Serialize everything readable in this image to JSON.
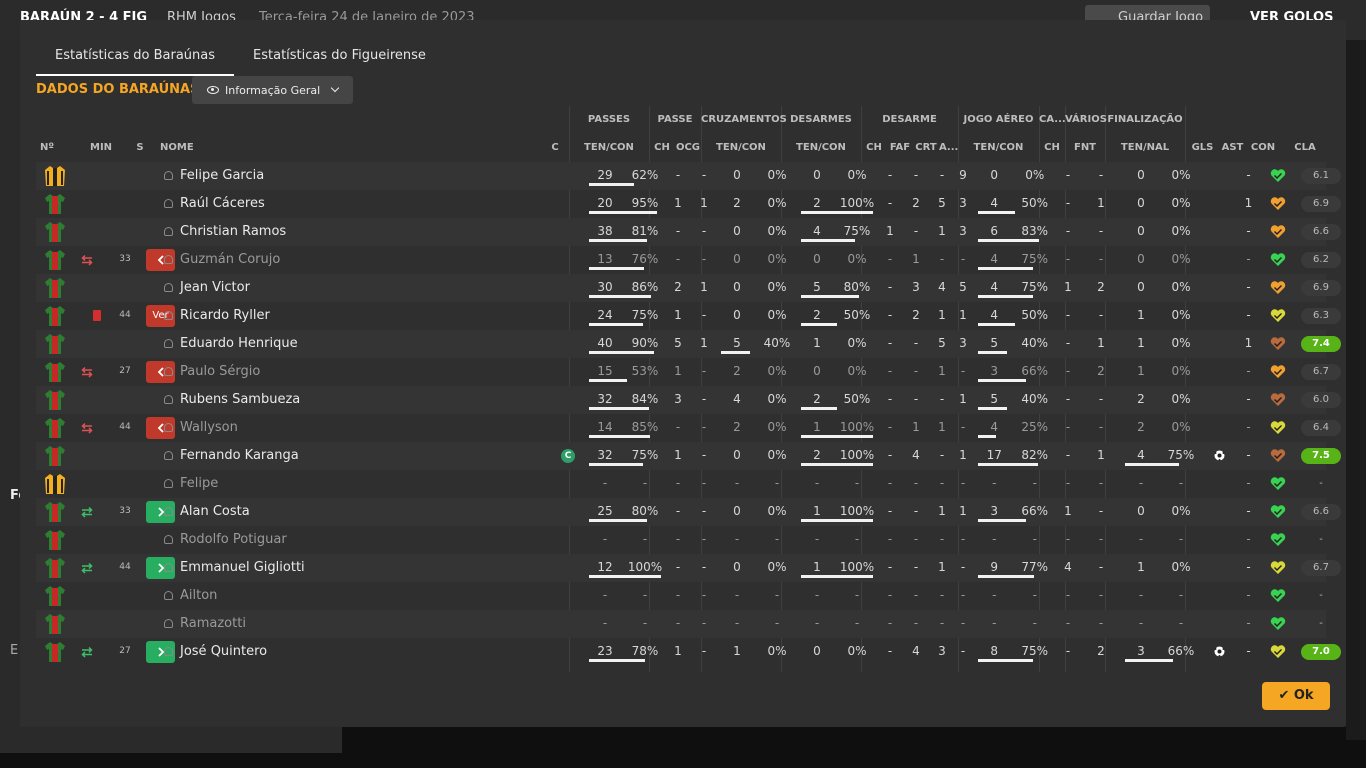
{
  "background": {
    "score": "BARAÚN 2 - 4 FIG",
    "channel": "RHM Jogos",
    "date": "Terça-feira 24 de Janeiro de 2023",
    "save_button": "Guardar Jogo",
    "goals_button": "VER GOLOS",
    "side_letter_1": "Fo",
    "side_letter_2": "E"
  },
  "tabs": [
    {
      "label": "Estatísticas do Baraúnas",
      "active": true
    },
    {
      "label": "Estatísticas do Figueirense",
      "active": false
    }
  ],
  "team_title": "DADOS DO BARAÚNAS",
  "view_dropdown": {
    "label": "Informação Geral",
    "icon": "eye-icon"
  },
  "group_headers": [
    "PASSES",
    "PASSE",
    "CRUZAMENTOS",
    "DESARMES",
    "DESARME",
    "JOGO AÉREO",
    "CA...",
    "VÁRIOS",
    "FINALIZAÇÃO"
  ],
  "columns": [
    "Nº",
    "MIN",
    "S",
    "NOME",
    "C",
    "TEN/CON",
    "CH",
    "OCG",
    "TEN/CON",
    "TEN/CON",
    "CH",
    "FAF",
    "CRT",
    "A...",
    "TEN/CON",
    "CH",
    "FNT",
    "TEN/NAL",
    "GLS",
    "AST",
    "CON",
    "CLA"
  ],
  "players": [
    {
      "name": "Felipe Garcia",
      "kit": "gk",
      "s": "",
      "min": "",
      "sub": "",
      "card": false,
      "captain": false,
      "dim": false,
      "passes": [
        "29",
        "62%"
      ],
      "passes_pct": 62,
      "passe": [
        "-",
        "-"
      ],
      "cruz": [
        "0",
        "0%"
      ],
      "cruz_pct": 0,
      "desarmes": [
        "0",
        "0%"
      ],
      "desarmes_pct": 0,
      "desarme": [
        "-",
        "-",
        "-",
        "9"
      ],
      "aereo": [
        "0",
        "0%"
      ],
      "aereo_pct": 0,
      "ca": "-",
      "fnt": "-",
      "fin": [
        "0",
        "0%"
      ],
      "fin_pct": 0,
      "gls": "",
      "ball": false,
      "ast": "-",
      "morale": "green",
      "rating": "6.1",
      "rating_hi": false
    },
    {
      "name": "Raúl Cáceres",
      "kit": "field",
      "s": "",
      "min": "",
      "sub": "",
      "card": false,
      "captain": false,
      "dim": false,
      "passes": [
        "20",
        "95%"
      ],
      "passes_pct": 95,
      "passe": [
        "1",
        "1"
      ],
      "cruz": [
        "2",
        "0%"
      ],
      "cruz_pct": 0,
      "desarmes": [
        "2",
        "100%"
      ],
      "desarmes_pct": 100,
      "desarme": [
        "-",
        "2",
        "5",
        "3"
      ],
      "aereo": [
        "4",
        "50%"
      ],
      "aereo_pct": 50,
      "ca": "-",
      "fnt": "1",
      "fin": [
        "0",
        "0%"
      ],
      "fin_pct": 0,
      "gls": "",
      "ball": false,
      "ast": "1",
      "morale": "orange",
      "rating": "6.9",
      "rating_hi": false
    },
    {
      "name": "Christian Ramos",
      "kit": "field",
      "s": "",
      "min": "",
      "sub": "",
      "card": false,
      "captain": false,
      "dim": false,
      "passes": [
        "38",
        "81%"
      ],
      "passes_pct": 81,
      "passe": [
        "-",
        "-"
      ],
      "cruz": [
        "0",
        "0%"
      ],
      "cruz_pct": 0,
      "desarmes": [
        "4",
        "75%"
      ],
      "desarmes_pct": 75,
      "desarme": [
        "1",
        "-",
        "1",
        "3"
      ],
      "aereo": [
        "6",
        "83%"
      ],
      "aereo_pct": 83,
      "ca": "-",
      "fnt": "-",
      "fin": [
        "0",
        "0%"
      ],
      "fin_pct": 0,
      "gls": "",
      "ball": false,
      "ast": "-",
      "morale": "orange",
      "rating": "6.6",
      "rating_hi": false
    },
    {
      "name": "Guzmán Corujo",
      "kit": "field",
      "s": "out",
      "min": "33",
      "sub": "out",
      "card": false,
      "captain": false,
      "dim": true,
      "passes": [
        "13",
        "76%"
      ],
      "passes_pct": 76,
      "passe": [
        "-",
        "-"
      ],
      "cruz": [
        "0",
        "0%"
      ],
      "cruz_pct": 0,
      "desarmes": [
        "0",
        "0%"
      ],
      "desarmes_pct": 0,
      "desarme": [
        "-",
        "1",
        "-",
        "-"
      ],
      "aereo": [
        "4",
        "75%"
      ],
      "aereo_pct": 75,
      "ca": "-",
      "fnt": "-",
      "fin": [
        "0",
        "0%"
      ],
      "fin_pct": 0,
      "gls": "",
      "ball": false,
      "ast": "-",
      "morale": "green",
      "rating": "6.2",
      "rating_hi": false
    },
    {
      "name": "Jean Victor",
      "kit": "field",
      "s": "",
      "min": "",
      "sub": "",
      "card": false,
      "captain": false,
      "dim": false,
      "passes": [
        "30",
        "86%"
      ],
      "passes_pct": 86,
      "passe": [
        "2",
        "1"
      ],
      "cruz": [
        "0",
        "0%"
      ],
      "cruz_pct": 0,
      "desarmes": [
        "5",
        "80%"
      ],
      "desarmes_pct": 80,
      "desarme": [
        "-",
        "3",
        "4",
        "5"
      ],
      "aereo": [
        "4",
        "75%"
      ],
      "aereo_pct": 75,
      "ca": "1",
      "fnt": "2",
      "fin": [
        "0",
        "0%"
      ],
      "fin_pct": 0,
      "gls": "",
      "ball": false,
      "ast": "-",
      "morale": "orange",
      "rating": "6.9",
      "rating_hi": false
    },
    {
      "name": "Ricardo Ryller",
      "kit": "field",
      "s": "ver",
      "min": "44",
      "sub": "",
      "card": true,
      "captain": false,
      "dim": false,
      "passes": [
        "24",
        "75%"
      ],
      "passes_pct": 75,
      "passe": [
        "1",
        "-"
      ],
      "cruz": [
        "0",
        "0%"
      ],
      "cruz_pct": 0,
      "desarmes": [
        "2",
        "50%"
      ],
      "desarmes_pct": 50,
      "desarme": [
        "-",
        "2",
        "1",
        "1"
      ],
      "aereo": [
        "4",
        "50%"
      ],
      "aereo_pct": 50,
      "ca": "-",
      "fnt": "-",
      "fin": [
        "1",
        "0%"
      ],
      "fin_pct": 0,
      "gls": "",
      "ball": false,
      "ast": "-",
      "morale": "yellow",
      "rating": "6.3",
      "rating_hi": false
    },
    {
      "name": "Eduardo Henrique",
      "kit": "field",
      "s": "",
      "min": "",
      "sub": "",
      "card": false,
      "captain": false,
      "dim": false,
      "passes": [
        "40",
        "90%"
      ],
      "passes_pct": 90,
      "passe": [
        "5",
        "1"
      ],
      "cruz": [
        "5",
        "40%"
      ],
      "cruz_pct": 40,
      "desarmes": [
        "1",
        "0%"
      ],
      "desarmes_pct": 0,
      "desarme": [
        "-",
        "-",
        "5",
        "3"
      ],
      "aereo": [
        "5",
        "40%"
      ],
      "aereo_pct": 40,
      "ca": "-",
      "fnt": "1",
      "fin": [
        "1",
        "0%"
      ],
      "fin_pct": 0,
      "gls": "",
      "ball": false,
      "ast": "1",
      "morale": "brown",
      "rating": "7.4",
      "rating_hi": true
    },
    {
      "name": "Paulo Sérgio",
      "kit": "field",
      "s": "out",
      "min": "27",
      "sub": "out",
      "card": false,
      "captain": false,
      "dim": true,
      "passes": [
        "15",
        "53%"
      ],
      "passes_pct": 53,
      "passe": [
        "1",
        "-"
      ],
      "cruz": [
        "2",
        "0%"
      ],
      "cruz_pct": 0,
      "desarmes": [
        "0",
        "0%"
      ],
      "desarmes_pct": 0,
      "desarme": [
        "-",
        "-",
        "1",
        "-"
      ],
      "aereo": [
        "3",
        "66%"
      ],
      "aereo_pct": 66,
      "ca": "-",
      "fnt": "2",
      "fin": [
        "1",
        "0%"
      ],
      "fin_pct": 0,
      "gls": "",
      "ball": false,
      "ast": "-",
      "morale": "orange",
      "rating": "6.7",
      "rating_hi": false
    },
    {
      "name": "Rubens Sambueza",
      "kit": "field",
      "s": "",
      "min": "",
      "sub": "",
      "card": false,
      "captain": false,
      "dim": false,
      "passes": [
        "32",
        "84%"
      ],
      "passes_pct": 84,
      "passe": [
        "3",
        "-"
      ],
      "cruz": [
        "4",
        "0%"
      ],
      "cruz_pct": 0,
      "desarmes": [
        "2",
        "50%"
      ],
      "desarmes_pct": 50,
      "desarme": [
        "-",
        "-",
        "-",
        "1"
      ],
      "aereo": [
        "5",
        "40%"
      ],
      "aereo_pct": 40,
      "ca": "-",
      "fnt": "-",
      "fin": [
        "2",
        "0%"
      ],
      "fin_pct": 0,
      "gls": "",
      "ball": false,
      "ast": "-",
      "morale": "brown",
      "rating": "6.0",
      "rating_hi": false
    },
    {
      "name": "Wallyson",
      "kit": "field",
      "s": "out",
      "min": "44",
      "sub": "out",
      "card": false,
      "captain": false,
      "dim": true,
      "passes": [
        "14",
        "85%"
      ],
      "passes_pct": 85,
      "passe": [
        "-",
        "-"
      ],
      "cruz": [
        "2",
        "0%"
      ],
      "cruz_pct": 0,
      "desarmes": [
        "1",
        "100%"
      ],
      "desarmes_pct": 100,
      "desarme": [
        "-",
        "1",
        "1",
        "-"
      ],
      "aereo": [
        "4",
        "25%"
      ],
      "aereo_pct": 25,
      "ca": "-",
      "fnt": "-",
      "fin": [
        "2",
        "0%"
      ],
      "fin_pct": 0,
      "gls": "",
      "ball": false,
      "ast": "-",
      "morale": "yellow",
      "rating": "6.4",
      "rating_hi": false
    },
    {
      "name": "Fernando Karanga",
      "kit": "field",
      "s": "",
      "min": "",
      "sub": "",
      "card": false,
      "captain": true,
      "dim": false,
      "passes": [
        "32",
        "75%"
      ],
      "passes_pct": 75,
      "passe": [
        "1",
        "-"
      ],
      "cruz": [
        "0",
        "0%"
      ],
      "cruz_pct": 0,
      "desarmes": [
        "2",
        "100%"
      ],
      "desarmes_pct": 100,
      "desarme": [
        "-",
        "4",
        "-",
        "1"
      ],
      "aereo": [
        "17",
        "82%"
      ],
      "aereo_pct": 82,
      "ca": "-",
      "fnt": "1",
      "fin": [
        "4",
        "75%"
      ],
      "fin_pct": 75,
      "gls": "",
      "ball": true,
      "ast": "-",
      "morale": "brown",
      "rating": "7.5",
      "rating_hi": true
    },
    {
      "name": "Felipe",
      "kit": "gk",
      "s": "",
      "min": "",
      "sub": "",
      "card": false,
      "captain": false,
      "dim": true,
      "passes": [
        "-",
        "-"
      ],
      "passes_pct": 0,
      "passe": [
        "-",
        "-"
      ],
      "cruz": [
        "-",
        "-"
      ],
      "cruz_pct": 0,
      "desarmes": [
        "-",
        "-"
      ],
      "desarmes_pct": 0,
      "desarme": [
        "-",
        "-",
        "-",
        "-"
      ],
      "aereo": [
        "-",
        "-"
      ],
      "aereo_pct": 0,
      "ca": "-",
      "fnt": "-",
      "fin": [
        "-",
        "-"
      ],
      "fin_pct": 0,
      "gls": "",
      "ball": false,
      "ast": "-",
      "morale": "green",
      "rating": "-",
      "rating_hi": false
    },
    {
      "name": "Alan Costa",
      "kit": "field",
      "s": "in",
      "min": "33",
      "sub": "in",
      "card": false,
      "captain": false,
      "dim": false,
      "passes": [
        "25",
        "80%"
      ],
      "passes_pct": 80,
      "passe": [
        "-",
        "-"
      ],
      "cruz": [
        "0",
        "0%"
      ],
      "cruz_pct": 0,
      "desarmes": [
        "1",
        "100%"
      ],
      "desarmes_pct": 100,
      "desarme": [
        "-",
        "-",
        "1",
        "1"
      ],
      "aereo": [
        "3",
        "66%"
      ],
      "aereo_pct": 66,
      "ca": "1",
      "fnt": "-",
      "fin": [
        "0",
        "0%"
      ],
      "fin_pct": 0,
      "gls": "",
      "ball": false,
      "ast": "-",
      "morale": "green",
      "rating": "6.6",
      "rating_hi": false
    },
    {
      "name": "Rodolfo Potiguar",
      "kit": "field",
      "s": "",
      "min": "",
      "sub": "",
      "card": false,
      "captain": false,
      "dim": true,
      "passes": [
        "-",
        "-"
      ],
      "passes_pct": 0,
      "passe": [
        "-",
        "-"
      ],
      "cruz": [
        "-",
        "-"
      ],
      "cruz_pct": 0,
      "desarmes": [
        "-",
        "-"
      ],
      "desarmes_pct": 0,
      "desarme": [
        "-",
        "-",
        "-",
        "-"
      ],
      "aereo": [
        "-",
        "-"
      ],
      "aereo_pct": 0,
      "ca": "-",
      "fnt": "-",
      "fin": [
        "-",
        "-"
      ],
      "fin_pct": 0,
      "gls": "",
      "ball": false,
      "ast": "-",
      "morale": "green",
      "rating": "-",
      "rating_hi": false
    },
    {
      "name": "Emmanuel Gigliotti",
      "kit": "field",
      "s": "in",
      "min": "44",
      "sub": "in",
      "card": false,
      "captain": false,
      "dim": false,
      "passes": [
        "12",
        "100%"
      ],
      "passes_pct": 100,
      "passe": [
        "-",
        "-"
      ],
      "cruz": [
        "0",
        "0%"
      ],
      "cruz_pct": 0,
      "desarmes": [
        "1",
        "100%"
      ],
      "desarmes_pct": 100,
      "desarme": [
        "-",
        "-",
        "1",
        "-"
      ],
      "aereo": [
        "9",
        "77%"
      ],
      "aereo_pct": 77,
      "ca": "4",
      "fnt": "-",
      "fin": [
        "1",
        "0%"
      ],
      "fin_pct": 0,
      "gls": "",
      "ball": false,
      "ast": "-",
      "morale": "yellow",
      "rating": "6.7",
      "rating_hi": false
    },
    {
      "name": "Ailton",
      "kit": "field",
      "s": "",
      "min": "",
      "sub": "",
      "card": false,
      "captain": false,
      "dim": true,
      "passes": [
        "-",
        "-"
      ],
      "passes_pct": 0,
      "passe": [
        "-",
        "-"
      ],
      "cruz": [
        "-",
        "-"
      ],
      "cruz_pct": 0,
      "desarmes": [
        "-",
        "-"
      ],
      "desarmes_pct": 0,
      "desarme": [
        "-",
        "-",
        "-",
        "-"
      ],
      "aereo": [
        "-",
        "-"
      ],
      "aereo_pct": 0,
      "ca": "-",
      "fnt": "-",
      "fin": [
        "-",
        "-"
      ],
      "fin_pct": 0,
      "gls": "",
      "ball": false,
      "ast": "-",
      "morale": "green",
      "rating": "-",
      "rating_hi": false
    },
    {
      "name": "Ramazotti",
      "kit": "field",
      "s": "",
      "min": "",
      "sub": "",
      "card": false,
      "captain": false,
      "dim": true,
      "passes": [
        "-",
        "-"
      ],
      "passes_pct": 0,
      "passe": [
        "-",
        "-"
      ],
      "cruz": [
        "-",
        "-"
      ],
      "cruz_pct": 0,
      "desarmes": [
        "-",
        "-"
      ],
      "desarmes_pct": 0,
      "desarme": [
        "-",
        "-",
        "-",
        "-"
      ],
      "aereo": [
        "-",
        "-"
      ],
      "aereo_pct": 0,
      "ca": "-",
      "fnt": "-",
      "fin": [
        "-",
        "-"
      ],
      "fin_pct": 0,
      "gls": "",
      "ball": false,
      "ast": "-",
      "morale": "green",
      "rating": "-",
      "rating_hi": false
    },
    {
      "name": "José Quintero",
      "kit": "field",
      "s": "in",
      "min": "27",
      "sub": "in",
      "card": false,
      "captain": false,
      "dim": false,
      "passes": [
        "23",
        "78%"
      ],
      "passes_pct": 78,
      "passe": [
        "1",
        "-"
      ],
      "cruz": [
        "1",
        "0%"
      ],
      "cruz_pct": 0,
      "desarmes": [
        "0",
        "0%"
      ],
      "desarmes_pct": 0,
      "desarme": [
        "-",
        "4",
        "3",
        "-"
      ],
      "aereo": [
        "8",
        "75%"
      ],
      "aereo_pct": 75,
      "ca": "-",
      "fnt": "2",
      "fin": [
        "3",
        "66%"
      ],
      "fin_pct": 66,
      "gls": "",
      "ball": true,
      "ast": "-",
      "morale": "yellow",
      "rating": "7.0",
      "rating_hi": true
    }
  ],
  "ver_label": "Ver",
  "captain_label": "C",
  "ok_button": "Ok",
  "colors": {
    "accent": "#f5a623",
    "green_badge": "#27ae60",
    "red_badge": "#c0392b",
    "rating_hi": "#58b317"
  }
}
